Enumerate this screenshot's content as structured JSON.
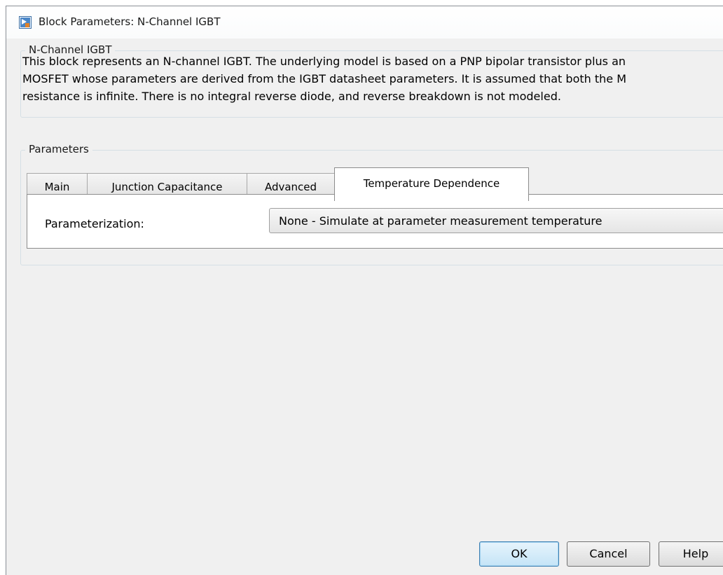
{
  "window": {
    "title": "Block Parameters: N-Channel IGBT",
    "icon": "simulink-block-icon"
  },
  "description_group": {
    "legend": "N-Channel IGBT",
    "lines": [
      "This block represents an N-channel IGBT. The underlying model is based on a PNP bipolar transistor plus an",
      "MOSFET whose parameters are derived from the IGBT datasheet parameters. It is assumed that both the M",
      "resistance is infinite. There is no integral reverse diode, and reverse breakdown is not modeled."
    ]
  },
  "parameters_group": {
    "legend": "Parameters",
    "tabs": [
      {
        "label": "Main",
        "active": false
      },
      {
        "label": "Junction Capacitance",
        "active": false
      },
      {
        "label": "Advanced",
        "active": false
      },
      {
        "label": "Temperature Dependence",
        "active": true
      }
    ],
    "parameterization": {
      "label": "Parameterization:",
      "value": "None - Simulate at parameter measurement temperature"
    }
  },
  "buttons": {
    "ok": "OK",
    "cancel": "Cancel",
    "help": "Help"
  },
  "colors": {
    "dialog_bg": "#f0f0f0",
    "default_button": "#c4e4f7",
    "group_border": "#d5dfe5"
  }
}
